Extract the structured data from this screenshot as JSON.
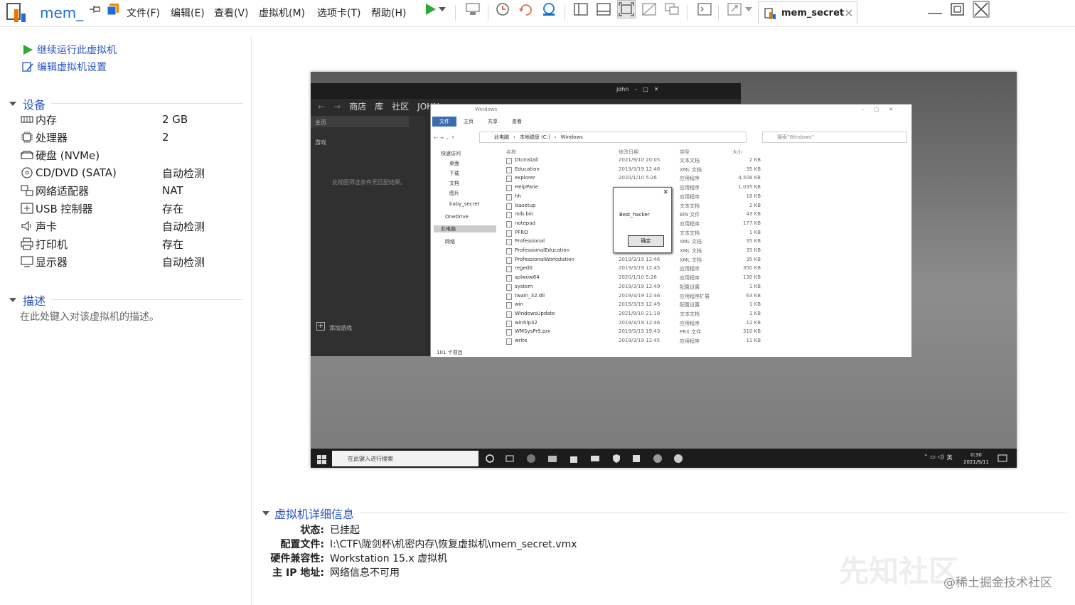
{
  "app": {
    "name": "mem_"
  },
  "menu": [
    "文件(F)",
    "编辑(E)",
    "查看(V)",
    "虚拟机(M)",
    "选项卡(T)",
    "帮助(H)"
  ],
  "tab": {
    "title": "mem_secret"
  },
  "actions": {
    "resume": "继续运行此虚拟机",
    "edit_settings": "编辑虚拟机设置"
  },
  "devices_section": "设备",
  "devices": [
    {
      "name": "内存",
      "value": "2 GB",
      "icon": "memory-icon"
    },
    {
      "name": "处理器",
      "value": "2",
      "icon": "cpu-icon"
    },
    {
      "name": "硬盘 (NVMe)",
      "value": "",
      "icon": "disk-icon"
    },
    {
      "name": "CD/DVD (SATA)",
      "value": "自动检测",
      "icon": "cdrom-icon"
    },
    {
      "name": "网络适配器",
      "value": "NAT",
      "icon": "network-icon"
    },
    {
      "name": "USB 控制器",
      "value": "存在",
      "icon": "usb-icon"
    },
    {
      "name": "声卡",
      "value": "自动检测",
      "icon": "speaker-icon"
    },
    {
      "name": "打印机",
      "value": "存在",
      "icon": "printer-icon"
    },
    {
      "name": "显示器",
      "value": "自动检测",
      "icon": "monitor-icon"
    }
  ],
  "description_section": "描述",
  "description_placeholder": "在此处键入对该虚拟机的描述。",
  "details": {
    "title": "虚拟机详细信息",
    "state_label": "状态:",
    "state": "已挂起",
    "config_label": "配置文件:",
    "config": "I:\\CTF\\陇剑杯\\机密内存\\恢复虚拟机\\mem_secret.vmx",
    "compat_label": "硬件兼容性:",
    "compat": "Workstation 15.x 虚拟机",
    "ip_label": "主 IP 地址:",
    "ip": "网络信息不可用"
  },
  "guest": {
    "steam": {
      "nav": [
        "商店",
        "库",
        "社区",
        "JOHN"
      ],
      "home": "主页",
      "games": "游戏",
      "empty": "此视图筛选条件无匹配结果。",
      "add_game": "添加游戏",
      "user": "john"
    },
    "explorer": {
      "title": "Windows",
      "ribbon": [
        "文件",
        "主页",
        "共享",
        "查看"
      ],
      "path": [
        "此电脑",
        "本地磁盘 (C:)",
        "Windows"
      ],
      "search": "搜索\"Windows\"",
      "nav": [
        {
          "label": "快速访问"
        },
        {
          "label": "桌面"
        },
        {
          "label": "下载"
        },
        {
          "label": "文档"
        },
        {
          "label": "图片"
        },
        {
          "label": "baby_secret"
        },
        {
          "label": "OneDrive"
        },
        {
          "label": "此电脑"
        },
        {
          "label": "网络"
        }
      ],
      "columns": [
        "名称",
        "修改日期",
        "类型",
        "大小"
      ],
      "files": [
        {
          "name": "DtcInstall",
          "date": "2021/9/10 20:05",
          "type": "文本文档",
          "size": "2 KB"
        },
        {
          "name": "Education",
          "date": "2019/3/19 12:46",
          "type": "XML 文档",
          "size": "35 KB"
        },
        {
          "name": "explorer",
          "date": "2020/1/10 5:26",
          "type": "应用程序",
          "size": "4,508 KB"
        },
        {
          "name": "HelpPane",
          "date": "",
          "type": "应用程序",
          "size": "1,035 KB"
        },
        {
          "name": "hh",
          "date": "",
          "type": "应用程序",
          "size": "18 KB"
        },
        {
          "name": "lsasetup",
          "date": "",
          "type": "文本文档",
          "size": "2 KB"
        },
        {
          "name": "mib.bin",
          "date": "",
          "type": "BIN 文件",
          "size": "43 KB"
        },
        {
          "name": "notepad",
          "date": "",
          "type": "应用程序",
          "size": "177 KB"
        },
        {
          "name": "PFRO",
          "date": "",
          "type": "文本文档",
          "size": "1 KB"
        },
        {
          "name": "Professional",
          "date": "",
          "type": "XML 文档",
          "size": "35 KB"
        },
        {
          "name": "ProfessionalEducation",
          "date": "2019/3/19 12:46",
          "type": "XML 文档",
          "size": "35 KB"
        },
        {
          "name": "ProfessionalWorkstation",
          "date": "2019/3/19 12:46",
          "type": "XML 文档",
          "size": "35 KB"
        },
        {
          "name": "regedit",
          "date": "2019/3/19 12:45",
          "type": "应用程序",
          "size": "350 KB"
        },
        {
          "name": "splwow64",
          "date": "2020/1/10 5:26",
          "type": "应用程序",
          "size": "130 KB"
        },
        {
          "name": "system",
          "date": "2019/3/19 12:49",
          "type": "配置设置",
          "size": "1 KB"
        },
        {
          "name": "twain_32.dll",
          "date": "2019/3/19 12:46",
          "type": "应用程序扩展",
          "size": "63 KB"
        },
        {
          "name": "win",
          "date": "2019/3/19 12:49",
          "type": "配置设置",
          "size": "1 KB"
        },
        {
          "name": "WindowsUpdate",
          "date": "2021/9/10 21:18",
          "type": "文本文档",
          "size": "1 KB"
        },
        {
          "name": "winhlp32",
          "date": "2019/3/19 12:46",
          "type": "应用程序",
          "size": "12 KB"
        },
        {
          "name": "WMSysPr9.prx",
          "date": "2019/3/19 19:43",
          "type": "PRX 文件",
          "size": "310 KB"
        },
        {
          "name": "write",
          "date": "2019/3/19 12:45",
          "type": "应用程序",
          "size": "11 KB"
        }
      ],
      "status": "101 个项目"
    },
    "dialog": {
      "message": "Best_hacker",
      "ok": "确定"
    },
    "taskbar": {
      "search": "在此键入进行搜索",
      "ime": "英",
      "time": "0:30",
      "date": "2021/9/11"
    }
  },
  "watermark": "@稀土掘金技术社区",
  "watermark_logo": "先知社区",
  "colors": {
    "accent": "#2a55c6",
    "play": "#2fa836",
    "vm_accent": "#f08a00"
  }
}
